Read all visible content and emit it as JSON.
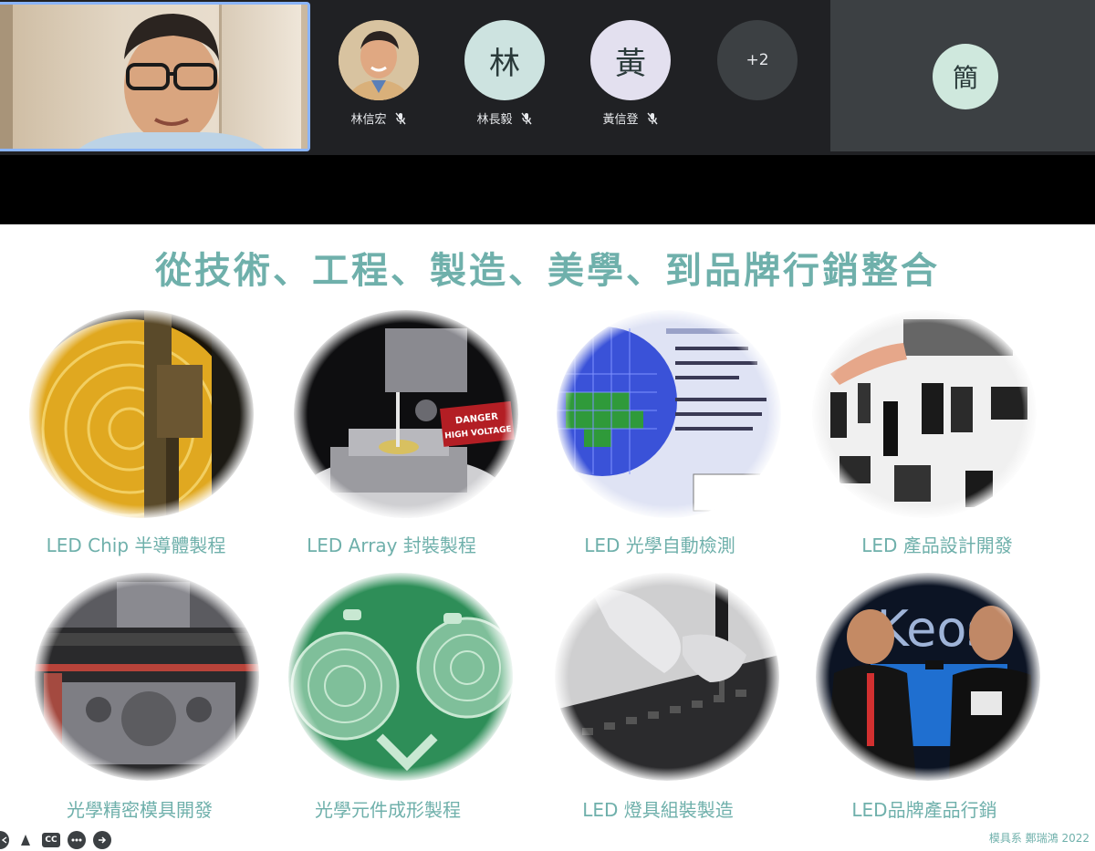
{
  "participants": [
    {
      "name": "林信宏",
      "initial": "",
      "avatar_color": "#c9a66b",
      "is_photo": true
    },
    {
      "name": "林長毅",
      "initial": "林",
      "avatar_color": "#cde3e0",
      "is_photo": false
    },
    {
      "name": "黃信登",
      "initial": "黃",
      "avatar_color": "#e3e0ef",
      "is_photo": false
    }
  ],
  "more_participants": "+2",
  "side_participant": {
    "initial": "簡",
    "avatar_color": "#cfe8dd"
  },
  "slide": {
    "title": "從技術、工程、製造、美學、到品牌行銷整合",
    "accent_color": "#6fb0ab",
    "items": [
      {
        "caption": "LED Chip 半導體製程"
      },
      {
        "caption": "LED Array 封裝製程"
      },
      {
        "caption": "LED 光學自動檢測"
      },
      {
        "caption": "LED 產品設計開發"
      },
      {
        "caption": "光學精密模具開發"
      },
      {
        "caption": "光學元件成形製程"
      },
      {
        "caption": "LED 燈具組裝製造"
      },
      {
        "caption": "LED品牌產品行銷"
      }
    ],
    "credit": "模具系 鄭瑞鴻 2022"
  },
  "photo_text": {
    "danger_label_1": "DANGER",
    "danger_label_2": "HIGH VOLTAGE",
    "brand_sign": "Keos"
  },
  "toolbar": {
    "cc_label": "CC"
  }
}
